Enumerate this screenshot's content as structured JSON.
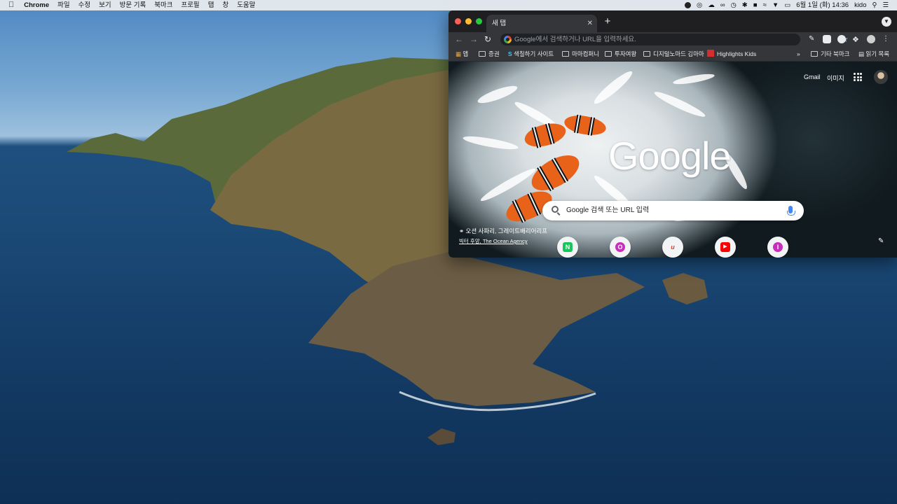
{
  "menubar": {
    "app_name": "Chrome",
    "items": [
      "파일",
      "수정",
      "보기",
      "방문 기록",
      "북마크",
      "프로필",
      "탭",
      "창",
      "도움말"
    ],
    "clock": "6월 1일 (화) 14:36",
    "user": "kido"
  },
  "chrome": {
    "tab_title": "새 탭",
    "omnibox_placeholder": "Google에서 검색하거나 URL을 입력하세요.",
    "bookmarks": [
      "앱",
      "증권",
      "색칠하기 사이트",
      "마마컴퍼니",
      "투자여왕",
      "디지털노마드 김마마",
      "Highlights Kids"
    ],
    "bookmarks_overflow": "»",
    "other_bookmarks": "기타 북마크",
    "reading_list": "읽기 목록"
  },
  "ntp": {
    "logo": "Google",
    "gmail": "Gmail",
    "images": "이미지",
    "search_placeholder": "Google 검색 또는 URL 입력",
    "attribution_title": "오션 사파리, 그레이트배리어리프",
    "attribution_credit": "빅터 후앙, The Ocean Agency",
    "shortcuts": [
      {
        "letter": "N",
        "color": "#19c55a"
      },
      {
        "letter": "O",
        "color": "#c82dbd"
      },
      {
        "letter": "u",
        "color": "#ffffff"
      },
      {
        "letter": "▶",
        "color": "#ff0000"
      },
      {
        "letter": "I",
        "color": "#c82dbd"
      }
    ]
  },
  "colors": {
    "accent": "#8ab4f8",
    "tab_bg": "#35363a",
    "frame_bg": "#202124"
  }
}
